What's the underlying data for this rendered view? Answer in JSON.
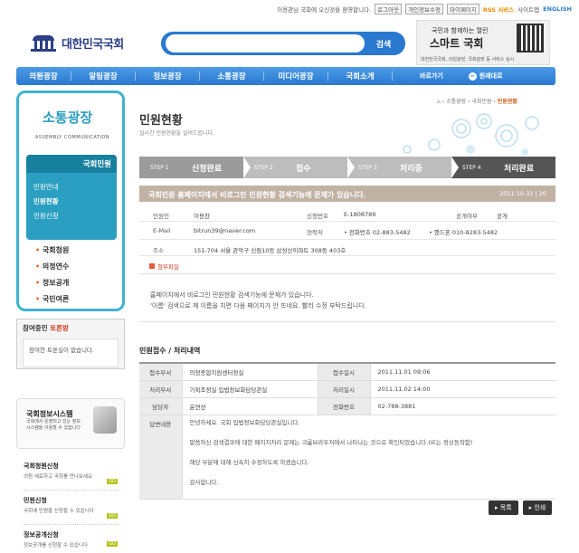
{
  "topbar": {
    "welcome": "이용관님 국회에 오신것을 환영합니다.",
    "logout": "로그아웃",
    "edit": "개인정보수정",
    "mypage": "마이페이지",
    "rss": "RSS 서비스",
    "sitemap": "사이트맵",
    "english": "ENGLISH"
  },
  "header": {
    "logo": "대한민국국회",
    "search_placeholder": "",
    "search_button": "검색",
    "promo_line1": "국민과 함께하는 열린",
    "promo_line2": "스마트 국회",
    "promo_line3": "대한민국국회, 의원광장, 국회광장 등 서비스 실시"
  },
  "nav": {
    "items": [
      "의원광장",
      "알림광장",
      "정보광장",
      "소통광장",
      "미디어광장",
      "국회소개"
    ],
    "quick": "바로가기",
    "original": "원래대로",
    "original_icon": "−"
  },
  "sidebar": {
    "title": "소통광장",
    "subtitle": "ASSEMBLY COMMUNICATION",
    "menu_header": "국회민원",
    "menu_chevron": "⌄",
    "menu_items": [
      "민원안내",
      "민원현황",
      "민원신청"
    ],
    "secondary": [
      "국회청원",
      "의정연수",
      "정보공개",
      "국민여론"
    ]
  },
  "debate": {
    "title_prefix": "참여중인",
    "title_accent": "토론방",
    "empty": "참여한 토론실이 없습니다."
  },
  "info": {
    "title": "국회정보시스템",
    "desc": "국회에서 운영되고 있는 정보시스템을 이용할 수 있습니다"
  },
  "side_blocks": [
    {
      "title": "국회청원신청",
      "desc": "의원 세료하고 국회를 만나보세요",
      "go": "GO"
    },
    {
      "title": "민원신청",
      "desc": "국회에 민원을 신청할 수 있습니다",
      "go": "GO"
    },
    {
      "title": "정보공개신청",
      "desc": "정보공개를 신청할 수 있습니다",
      "go": "GO"
    }
  ],
  "breadcrumb": {
    "sep1": "›",
    "item1": "소통광장",
    "sep2": "›",
    "item2": "국회민원",
    "sep3": "›",
    "current": "민원현황"
  },
  "page": {
    "title": "민원현황",
    "subtitle": "실시간 민원현황을 알려드립니다."
  },
  "steps": [
    {
      "num": "STEP 1",
      "label": "신청완료"
    },
    {
      "num": "STEP 2",
      "label": "접수"
    },
    {
      "num": "STEP 3",
      "label": "처리중"
    },
    {
      "num": "STEP 4",
      "label": "처리완료"
    }
  ],
  "complaint": {
    "title": "국회민원 홈페이지에서 비로그인 민원현황 검색기능에 문제가 있습니다.",
    "date": "2011.10.31",
    "sep": "|",
    "views": "20",
    "labels": {
      "applicant": "민원인",
      "reg_no": "신청번호",
      "public": "공개여부",
      "email": "E-Mail",
      "contact": "연락처",
      "address": "주소"
    },
    "applicant": "이용찬",
    "reg_no": "E-1808789",
    "public": "공개",
    "email": "bitrun39@naver.com",
    "phone": "• 전화번호 02-883-5482",
    "mobile": "• 핸드폰 010-8283-5482",
    "address": "151-704 서울 관악구 신림10동 삼성산이파트 308동 403호",
    "attach": "첨부파일",
    "body": [
      "홈페이지에서 비로그인 민원현황 검색기능에 문제가 있습니다.",
      "'이름' 검색으로 제 이름을 치면 다음 페이지가 안 뜨네요. 빨리 수정 부탁드립니다."
    ]
  },
  "process": {
    "title": "민원접수 / 처리내역",
    "labels": {
      "dept": "접수부서",
      "date": "접수일시",
      "handler_dept": "처리부서",
      "handle_date": "처리일시",
      "person": "담당자",
      "phone": "전화번호",
      "answer": "답변내용"
    },
    "dept": "의정종합지원센터정실",
    "date": "2011.11.01 09:06",
    "handler_dept": "기획조정실 입법정보화담당관실",
    "handle_date": "2011.11.02 14:00",
    "person": "윤연선",
    "phone": "02-788-3881",
    "answer": [
      "안녕하세요. 국회 입법정보화담당관실입니다.",
      "말씀하신 검색결과에 대한 페이지처리 문제는 크롬브라우저에서 나타나는 것으로 확인되었습니다.(IE는 정상동작함)",
      "해당 부분에 대해 신속히 수정하도록 하겠습니다.",
      "감사합니다."
    ]
  },
  "buttons": {
    "list": "▸ 목록",
    "print": "▸ 인쇄"
  }
}
